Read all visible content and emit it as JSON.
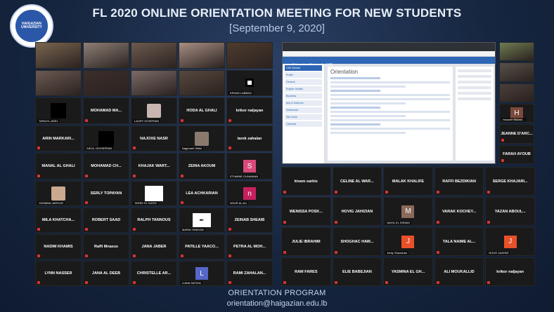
{
  "header": {
    "title": "FL 2020 ONLINE ORIENTATION MEETING FOR NEW STUDENTS",
    "subtitle": "[September 9, 2020]",
    "logo_text": "HAIGAZIAN UNIVERSITY"
  },
  "share_screen": {
    "site_title": "Haigazian University LMS",
    "page_title": "Orientation",
    "nav_items": [
      "LMS Sidebar",
      "Profile",
      "General",
      "English Studies",
      "Business",
      "Arts & Sciences",
      "Dashboard",
      "Site home",
      "Calendar"
    ]
  },
  "grid_left": [
    {
      "name": "",
      "cap": "",
      "color": "#7a6650",
      "kind": "video"
    },
    {
      "name": "",
      "cap": "",
      "color": "#8e7f76",
      "kind": "video"
    },
    {
      "name": "",
      "cap": "",
      "color": "#6d5a4f",
      "kind": "video"
    },
    {
      "name": "",
      "cap": "",
      "color": "#a88f83",
      "kind": "video"
    },
    {
      "name": "",
      "cap": "",
      "color": "#4e3b2d",
      "kind": "video"
    },
    {
      "name": "",
      "cap": "",
      "color": "#6b5a52",
      "kind": "video"
    },
    {
      "name": "",
      "cap": "",
      "color": "#3c2e2a",
      "kind": "video"
    },
    {
      "name": "",
      "cap": "",
      "color": "#7b6b67",
      "kind": "video"
    },
    {
      "name": "",
      "cap": "",
      "color": "#56483e",
      "kind": "video"
    },
    {
      "name": "",
      "cap": "KENAN LABBAN",
      "color": "#000000",
      "kind": "whitesq"
    },
    {
      "name": "",
      "cap": "TARA EL-ADEL",
      "color": "#000000",
      "kind": "blacksq"
    },
    {
      "name": "MOHAMAD MA...",
      "cap": "",
      "color": "",
      "kind": "name"
    },
    {
      "name": "",
      "cap": "LAURY GOSEPIAN",
      "color": "#c9b6b0",
      "kind": "thumb"
    },
    {
      "name": "HODA AL GHALI",
      "cap": "",
      "color": "",
      "kind": "name"
    },
    {
      "name": "krikor naljayan",
      "cap": "",
      "color": "",
      "kind": "name"
    },
    {
      "name": "ARIN MARKARI...",
      "cap": "",
      "color": "",
      "kind": "name"
    },
    {
      "name": "",
      "cap": "SIEOL HOVSEPIAN",
      "color": "#000000",
      "kind": "blacksq"
    },
    {
      "name": "NAJOXE NASR",
      "cap": "",
      "color": "",
      "kind": "name"
    },
    {
      "name": "",
      "cap": "Naghmeh Hilliel",
      "color": "#8a7a6e",
      "kind": "thumb"
    },
    {
      "name": "tarek zahalan",
      "cap": "",
      "color": "",
      "kind": "name"
    },
    {
      "name": "MANAL AL GHALI",
      "cap": "",
      "color": "",
      "kind": "name"
    },
    {
      "name": "MOHAMAD CH...",
      "cap": "",
      "color": "",
      "kind": "name"
    },
    {
      "name": "KHAJAK WART...",
      "cap": "",
      "color": "",
      "kind": "name"
    },
    {
      "name": "ZEINA AKOUM",
      "cap": "",
      "color": "",
      "kind": "name"
    },
    {
      "name": "S",
      "cap": "ETHMINE OUNANIAN",
      "color": "#d94a7a",
      "kind": "letter"
    }
  ],
  "grid_bottom_left": [
    {
      "name": "",
      "cap": "YASMINA JAROUR",
      "color": "#caa98f",
      "kind": "thumb"
    },
    {
      "name": "SERLY TOPAYAN",
      "cap": "",
      "color": "",
      "kind": "name"
    },
    {
      "name": "",
      "cap": "TAREK EL KASSI",
      "color": "#ffffff",
      "kind": "whitebig"
    },
    {
      "name": "LEA ACHKARIAN",
      "cap": "",
      "color": "",
      "kind": "name"
    },
    {
      "name": "n",
      "cap": "NOUR AL ALI",
      "color": "#c7205e",
      "kind": "letter"
    },
    {
      "name": "MILA KHATCHA...",
      "cap": "",
      "color": "",
      "kind": "name"
    },
    {
      "name": "ROBERT SAAD",
      "cap": "",
      "color": "",
      "kind": "name"
    },
    {
      "name": "RALPH TANNOUS",
      "cap": "",
      "color": "",
      "kind": "name"
    },
    {
      "name": "",
      "cap": "MARIA YANKIAN",
      "color": "#ffffff",
      "kind": "whitesketch"
    },
    {
      "name": "ZEINAB SHEAIB",
      "cap": "",
      "color": "",
      "kind": "name"
    },
    {
      "name": "NADIM KHAMIS",
      "cap": "",
      "color": "",
      "kind": "name"
    },
    {
      "name": "Raffi Mnasss",
      "cap": "",
      "color": "",
      "kind": "name"
    },
    {
      "name": "JANA JABER",
      "cap": "",
      "color": "",
      "kind": "name"
    },
    {
      "name": "PATILLE YAACO...",
      "cap": "",
      "color": "",
      "kind": "name"
    },
    {
      "name": "PETRA AL MOH...",
      "cap": "",
      "color": "",
      "kind": "name"
    },
    {
      "name": "LYNN NASSER",
      "cap": "",
      "color": "",
      "kind": "name"
    },
    {
      "name": "JANA AL DEEB",
      "cap": "",
      "color": "",
      "kind": "name"
    },
    {
      "name": "CHRISTELLE AR...",
      "cap": "",
      "color": "",
      "kind": "name"
    },
    {
      "name": "L",
      "cap": "LIANA SATIAN",
      "color": "#5567c9",
      "kind": "letter"
    },
    {
      "name": "RAMI ZAHALAN...",
      "cap": "",
      "color": "",
      "kind": "name"
    }
  ],
  "grid_right_side": [
    {
      "name": "",
      "cap": "",
      "color": "#6e7c52",
      "kind": "video"
    },
    {
      "name": "",
      "cap": "",
      "color": "#585048",
      "kind": "video"
    },
    {
      "name": "",
      "cap": "",
      "color": "#4a3e3a",
      "kind": "video"
    },
    {
      "name": "H",
      "cap": "Hussein Mouss...",
      "color": "#7a4a3c",
      "kind": "letter"
    },
    {
      "name": "JEANNE D'ARC...",
      "cap": "",
      "color": "",
      "kind": "name"
    },
    {
      "name": "FARAH AYOUB",
      "cap": "",
      "color": "",
      "kind": "name"
    }
  ],
  "grid_bottom_right": [
    {
      "name": "kivam sarkis",
      "cap": "",
      "color": "",
      "kind": "name"
    },
    {
      "name": "CELINE AL WAR...",
      "cap": "",
      "color": "",
      "kind": "name"
    },
    {
      "name": "MALAK KHALIFE",
      "cap": "",
      "color": "",
      "kind": "name"
    },
    {
      "name": "RAFFI BEZDIKIAN",
      "cap": "",
      "color": "",
      "kind": "name"
    },
    {
      "name": "SERGE KHAJARI...",
      "cap": "",
      "color": "",
      "kind": "name"
    },
    {
      "name": "WENISSA POSK...",
      "cap": "",
      "color": "",
      "kind": "name"
    },
    {
      "name": "HOVIG JAHIZIAN",
      "cap": "",
      "color": "",
      "kind": "name"
    },
    {
      "name": "M",
      "cap": "NAHIL EL SIRAWI",
      "color": "#8a6a5a",
      "kind": "letter"
    },
    {
      "name": "VARAK KOCHEY...",
      "cap": "",
      "color": "",
      "kind": "name"
    },
    {
      "name": "YAZAN ABOUL...",
      "cap": "",
      "color": "",
      "kind": "name"
    },
    {
      "name": "JULIE IBRAHIM",
      "cap": "",
      "color": "",
      "kind": "name"
    },
    {
      "name": "SHOGHAC HAW...",
      "cap": "",
      "color": "",
      "kind": "name"
    },
    {
      "name": "J",
      "cap": "Jenly Ghazarian",
      "color": "#e8502a",
      "kind": "letter"
    },
    {
      "name": "TALA NAIME AL...",
      "cap": "",
      "color": "",
      "kind": "name"
    },
    {
      "name": "J",
      "cap": "NOUR JAAFAR",
      "color": "#e8502a",
      "kind": "letter"
    },
    {
      "name": "RAM FARES",
      "cap": "",
      "color": "",
      "kind": "name"
    },
    {
      "name": "ELIE BABEJIAN",
      "cap": "",
      "color": "",
      "kind": "name"
    },
    {
      "name": "YASMINA EL GH...",
      "cap": "",
      "color": "",
      "kind": "name"
    },
    {
      "name": "ALI MOUKALLID",
      "cap": "",
      "color": "",
      "kind": "name"
    },
    {
      "name": "krikor naljayan",
      "cap": "",
      "color": "",
      "kind": "name"
    }
  ],
  "footer": {
    "line1": "ORIENTATION PROGRAM",
    "line2": "orientation@haigazian.edu.lb"
  }
}
